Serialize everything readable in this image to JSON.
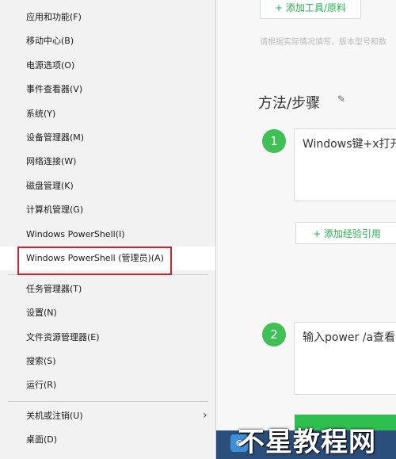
{
  "menu": {
    "items": [
      {
        "label": "应用和功能(F)"
      },
      {
        "label": "移动中心(B)"
      },
      {
        "label": "电源选项(O)"
      },
      {
        "label": "事件查看器(V)"
      },
      {
        "label": "系统(Y)"
      },
      {
        "label": "设备管理器(M)"
      },
      {
        "label": "网络连接(W)"
      },
      {
        "label": "磁盘管理(K)"
      },
      {
        "label": "计算机管理(G)"
      },
      {
        "label": "Windows PowerShell(I)"
      },
      {
        "label": "Windows PowerShell (管理员)(A)"
      },
      {
        "label": "任务管理器(T)"
      },
      {
        "label": "设置(N)"
      },
      {
        "label": "文件资源管理器(E)"
      },
      {
        "label": "搜索(S)"
      },
      {
        "label": "运行(R)"
      },
      {
        "label": "关机或注销(U)"
      },
      {
        "label": "桌面(D)"
      }
    ],
    "highlighted_item": "Windows PowerShell (管理员)(A)",
    "submenu_arrow": "chevron-right-icon"
  },
  "editor": {
    "add_tool_label": "+ 添加工具/原料",
    "hint": "请根据实际情况填写，版本型号和数",
    "steps_heading": "方法/步骤",
    "steps": [
      {
        "number": "1",
        "text": "Windows键+x打开"
      },
      {
        "number": "2",
        "text": "输入power /a查看"
      }
    ],
    "add_experience_label": "+ 添加经验引用"
  },
  "watermark": "不星教程网",
  "colors": {
    "accent_green": "#3ec054",
    "highlight_box": "#d4232b"
  }
}
